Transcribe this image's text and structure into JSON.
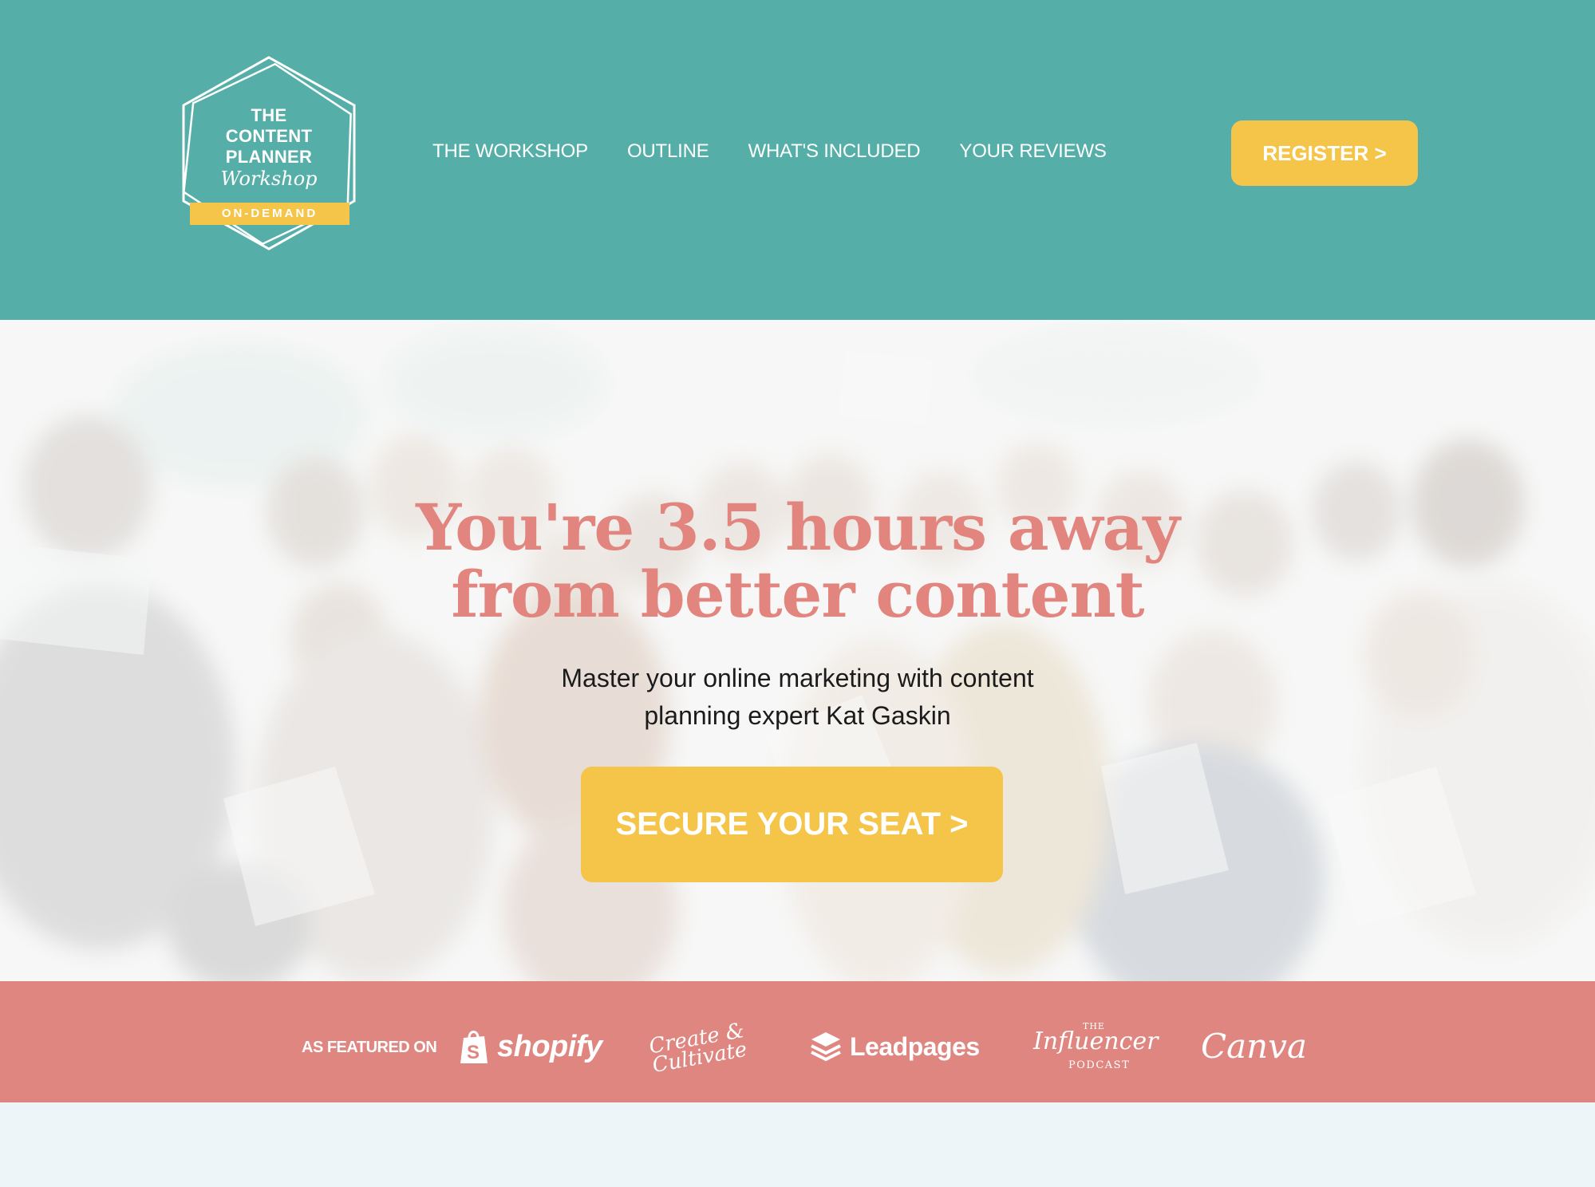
{
  "brand": {
    "logo_lines": [
      "THE",
      "CONTENT",
      "PLANNER"
    ],
    "logo_script": "Workshop",
    "logo_ribbon": "ON-DEMAND"
  },
  "nav": {
    "items": [
      {
        "label": "THE WORKSHOP"
      },
      {
        "label": "OUTLINE"
      },
      {
        "label": "WHAT'S INCLUDED"
      },
      {
        "label": "YOUR REVIEWS"
      }
    ],
    "register_label": "REGISTER >"
  },
  "hero": {
    "title_line1": "You're 3.5 hours away",
    "title_line2": "from better content",
    "subtitle_line1": "Master your online marketing with content",
    "subtitle_line2": "planning expert Kat Gaskin",
    "cta_label": "SECURE YOUR SEAT >"
  },
  "featured": {
    "label": "AS FEATURED ON",
    "logos": [
      {
        "name": "shopify",
        "text": "shopify",
        "icon": "shopping-bag-icon"
      },
      {
        "name": "create-and-cultivate",
        "text_line1": "Create &",
        "text_line2": "Cultivate"
      },
      {
        "name": "leadpages",
        "text": "Leadpages",
        "icon": "layers-icon"
      },
      {
        "name": "influencer-podcast",
        "text_top": "THE",
        "text_main": "Influencer",
        "text_bottom": "PODCAST"
      },
      {
        "name": "canva",
        "text": "Canva"
      }
    ]
  },
  "colors": {
    "header_teal": "#55AFA8",
    "accent_yellow": "#F5C54A",
    "coral": "#E08680",
    "headline_coral": "#E2857E",
    "bottom_bg": "#EDF5F8"
  }
}
